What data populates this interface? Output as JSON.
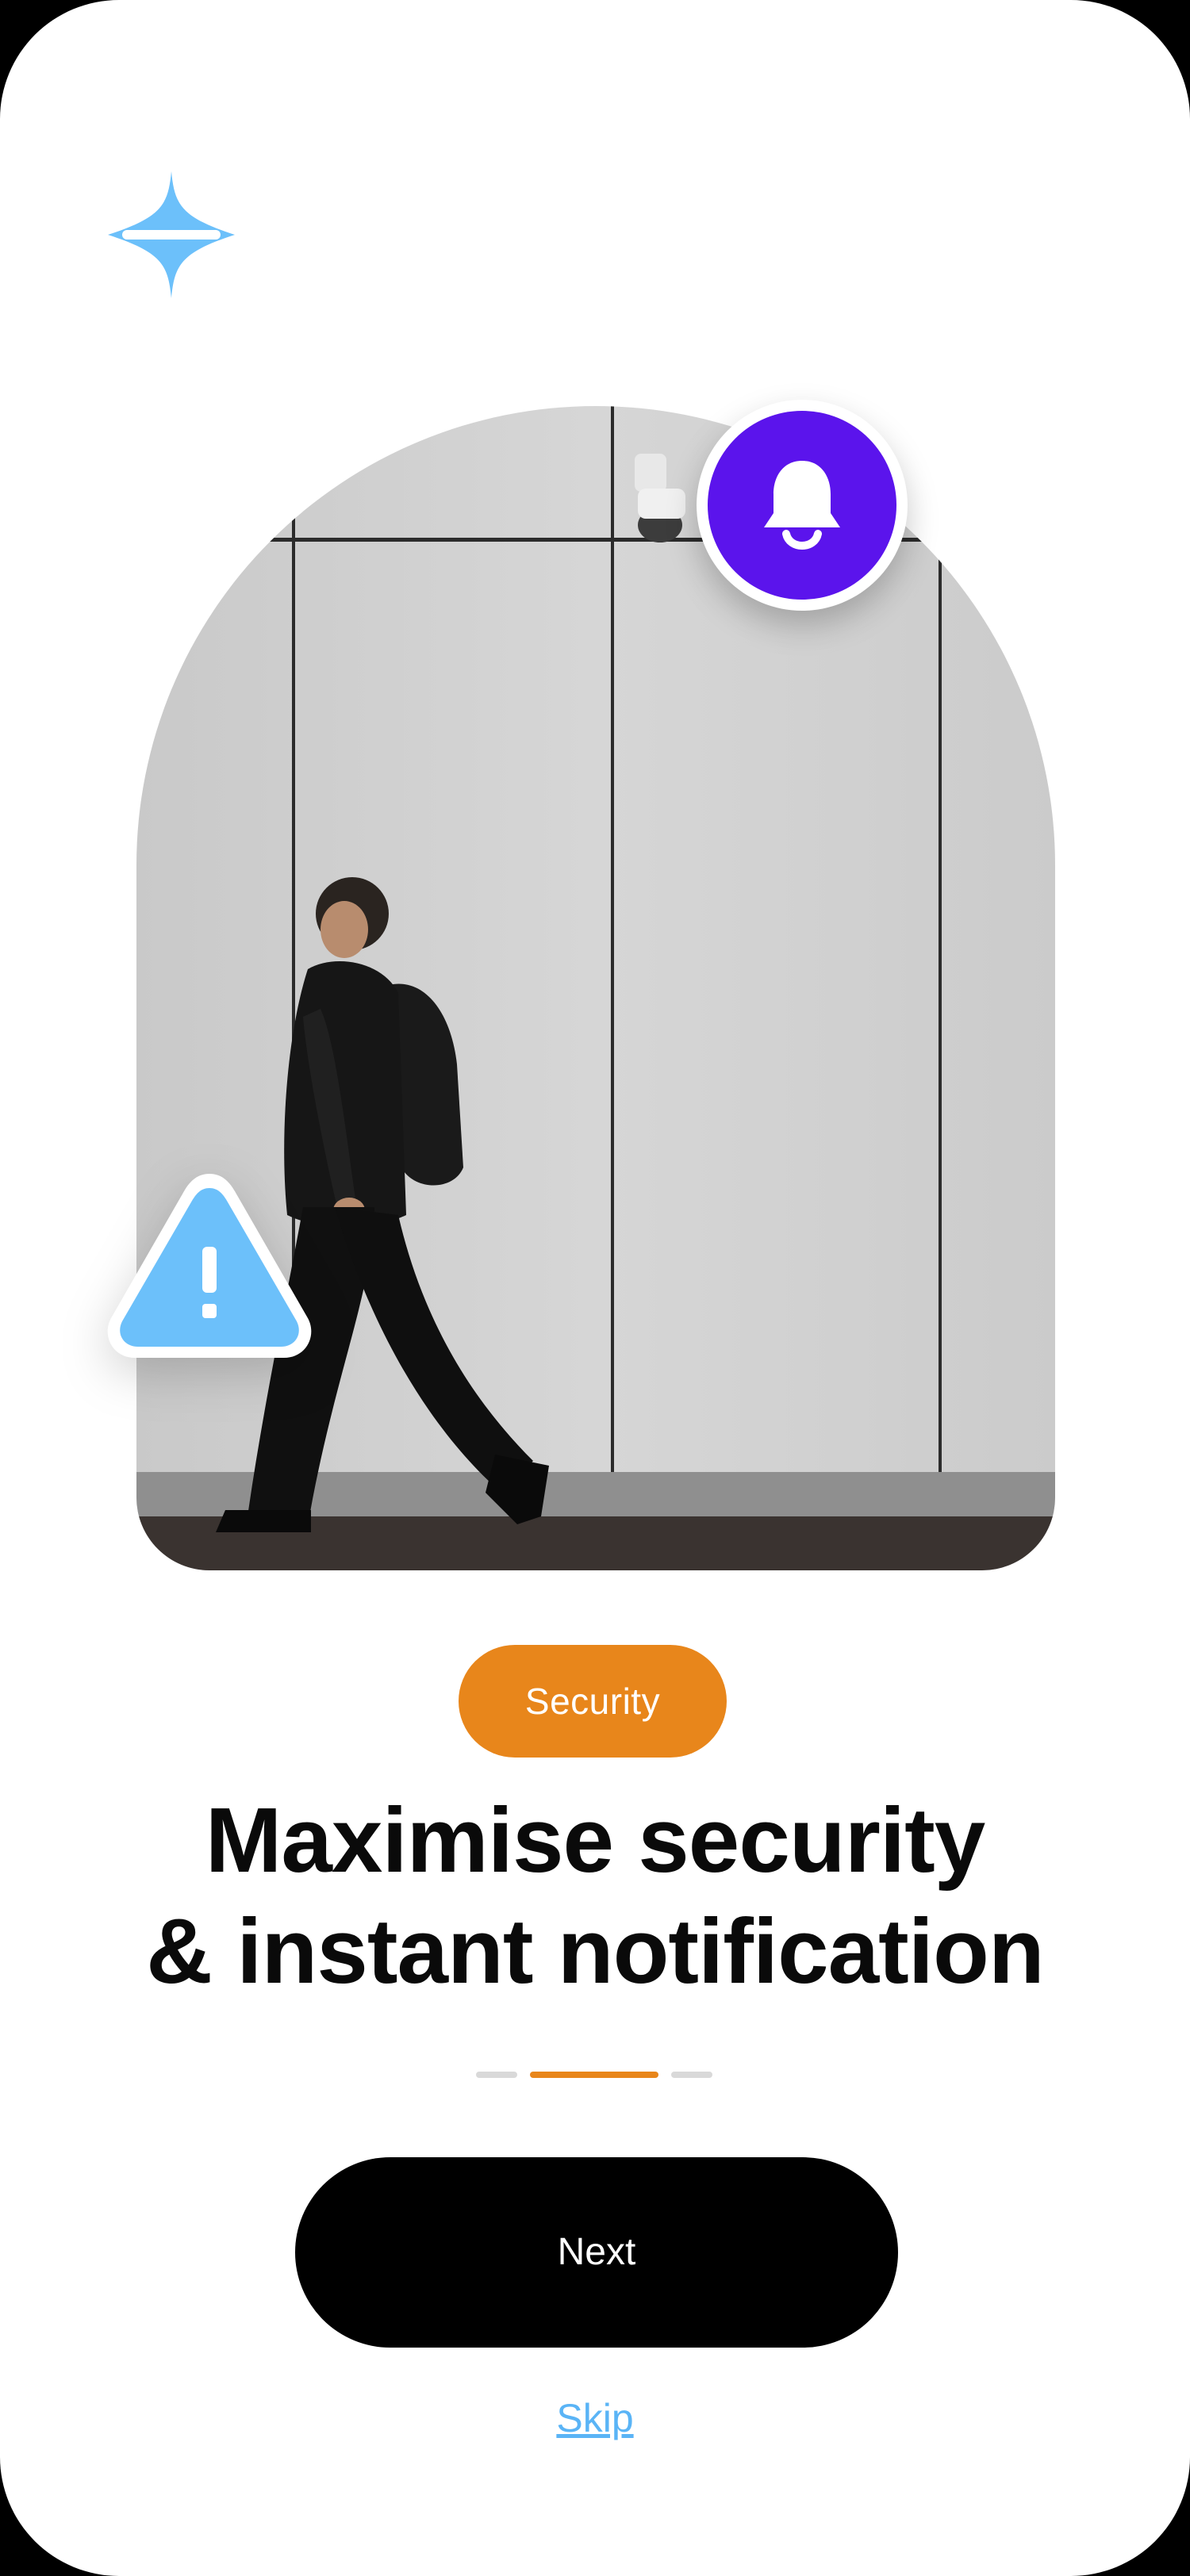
{
  "app": {
    "logo_icon": "sparkle-star-icon",
    "accent_blue": "#6cc0fa",
    "brand_purple": "#5b14ec",
    "brand_orange": "#e8861b"
  },
  "hero": {
    "image_description_icon": "person-walking-photo",
    "notification_icon": "bell-icon",
    "alert_icon": "warning-triangle-icon",
    "alert_symbol": "!"
  },
  "content": {
    "tag_label": "Security",
    "headline_line1": "Maximise security",
    "headline_line2": "& instant notification"
  },
  "pagination": {
    "total": 3,
    "active_index": 1
  },
  "actions": {
    "next_label": "Next",
    "skip_label": "Skip"
  }
}
